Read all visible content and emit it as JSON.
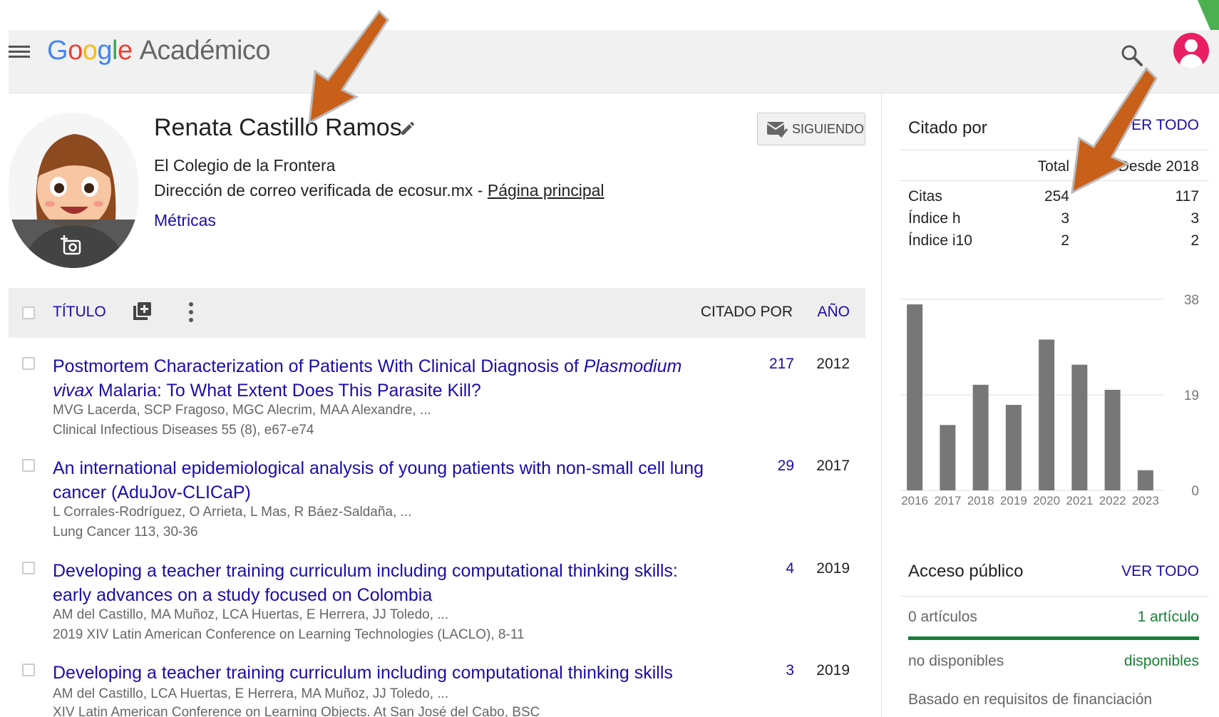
{
  "header": {
    "logo_google": "Google",
    "logo_product": "Académico",
    "menu_icon": "hamburger-menu-icon",
    "search_icon": "search-icon",
    "account_icon": "account-avatar-icon"
  },
  "profile": {
    "name": "Renata Castillo Ramos",
    "affiliation": "El Colegio de la Frontera",
    "email_prefix": "Dirección de correo verificada de ecosur.mx - ",
    "homepage_link": "Página principal",
    "interest_link": "Métricas",
    "follow_label": "SIGUIENDO",
    "follow_icon": "envelope-check-icon",
    "edit_icon": "pencil-icon"
  },
  "table": {
    "header_title": "TÍTULO",
    "header_cited_by": "CITADO POR",
    "header_year": "AÑO",
    "add_icon": "add-to-library-icon",
    "more_icon": "more-vert-icon",
    "articles": [
      {
        "title_pre": "Postmortem Characterization of Patients With Clinical Diagnosis of ",
        "title_italic": "Plasmodium vivax",
        "title_post": " Malaria: To What Extent Does This Parasite Kill?",
        "authors": "MVG Lacerda, SCP Fragoso, MGC Alecrim, MAA Alexandre, ...",
        "venue": "Clinical Infectious Diseases 55 (8), e67-e74",
        "cited_by": "217",
        "year": "2012"
      },
      {
        "title_pre": "An international epidemiological analysis of young patients with non-small cell lung cancer (AduJov-CLICaP)",
        "title_italic": "",
        "title_post": "",
        "authors": "L Corrales-Rodríguez, O Arrieta, L Mas, R Báez-Saldaña, ...",
        "venue": "Lung Cancer 113, 30-36",
        "cited_by": "29",
        "year": "2017"
      },
      {
        "title_pre": "Developing a teacher training curriculum including computational thinking skills: early advances on a study focused on Colombia",
        "title_italic": "",
        "title_post": "",
        "authors": "AM del Castillo, MA Muñoz, LCA Huertas, E Herrera, JJ Toledo, ...",
        "venue": "2019 XIV Latin American Conference on Learning Technologies (LACLO), 8-11",
        "cited_by": "4",
        "year": "2019"
      },
      {
        "title_pre": "Developing a teacher training curriculum including computational thinking skills",
        "title_italic": "",
        "title_post": "",
        "authors": "AM del Castillo, LCA Huertas, E Herrera, MA Muñoz, JJ Toledo, ...",
        "venue": "XIV Latin American Conference on Learning Objects. At San José del Cabo, BSC",
        "cited_by": "3",
        "year": "2019"
      }
    ]
  },
  "cited_by": {
    "title": "Citado por",
    "view_all": "VER TODO",
    "col_total": "Total",
    "col_since": "Desde 2018",
    "rows": [
      {
        "label": "Citas",
        "total": "254",
        "since": "117"
      },
      {
        "label": "Índice h",
        "total": "3",
        "since": "3"
      },
      {
        "label": "Índice i10",
        "total": "2",
        "since": "2"
      }
    ]
  },
  "chart_data": {
    "type": "bar",
    "categories": [
      "2016",
      "2017",
      "2018",
      "2019",
      "2020",
      "2021",
      "2022",
      "2023"
    ],
    "values": [
      37,
      13,
      21,
      17,
      30,
      25,
      20,
      4
    ],
    "ylim": [
      0,
      38
    ],
    "yticks": [
      "38",
      "19",
      "0"
    ],
    "ytick_values": [
      38,
      19,
      0
    ],
    "bar_color": "#777777",
    "grid": true
  },
  "public_access": {
    "title": "Acceso público",
    "view_all": "VER TODO",
    "left_count": "0 artículos",
    "right_count": "1 artículo",
    "left_label": "no disponibles",
    "right_label": "disponibles",
    "available_fraction": 1.0,
    "basis": "Basado en requisitos de financiación"
  },
  "colors": {
    "link": "#1a0dab",
    "green": "#188038",
    "arrow": "#c8601a"
  }
}
